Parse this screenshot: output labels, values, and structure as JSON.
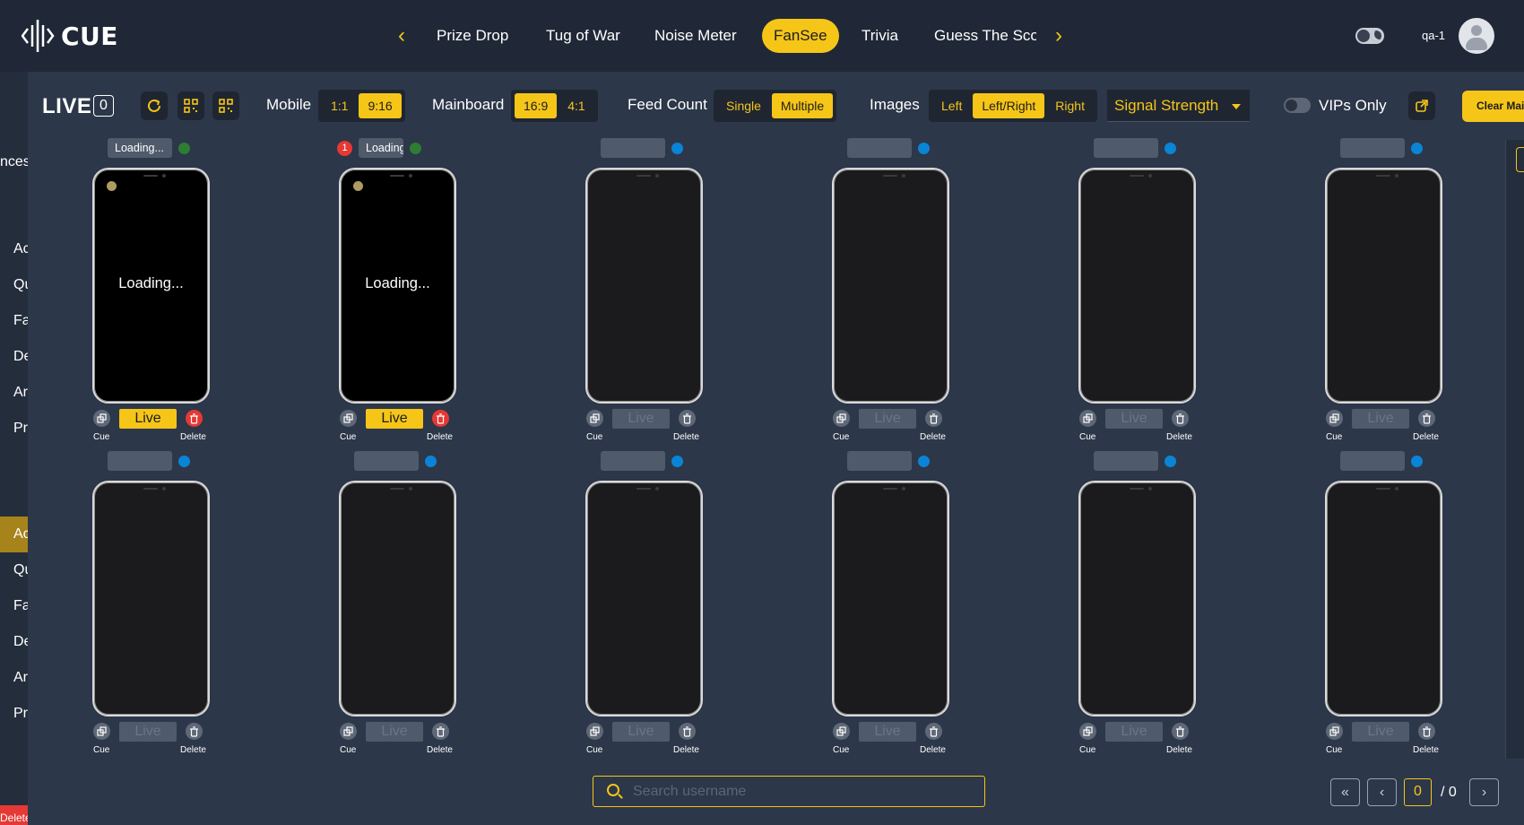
{
  "app": {
    "name": "CUE"
  },
  "nav": {
    "tabs": [
      {
        "label": "Prize Drop"
      },
      {
        "label": "Tug of War"
      },
      {
        "label": "Noise Meter"
      },
      {
        "label": "FanSee",
        "active": true
      },
      {
        "label": "Trivia"
      },
      {
        "label": "Guess The Sco"
      }
    ],
    "prev_icon": "chevron-left-icon",
    "next_icon": "chevron-right-icon"
  },
  "user": {
    "name": "qa-1"
  },
  "sidebar": {
    "top_fragment": "nces",
    "group1": [
      "Ac",
      "Qu",
      "Fa",
      "De",
      "Ar",
      "Pr"
    ],
    "group2": [
      "Ac",
      "Qu",
      "Fa",
      "De",
      "Ar",
      "Pr"
    ],
    "delete_label": "Delete"
  },
  "toolbar": {
    "title": "LIVE",
    "live_count": "0",
    "mobile": {
      "label": "Mobile",
      "options": [
        "1:1",
        "9:16"
      ],
      "selected": "9:16"
    },
    "mainboard": {
      "label": "Mainboard",
      "options": [
        "16:9",
        "4:1"
      ],
      "selected": "16:9"
    },
    "feed_count": {
      "label": "Feed Count",
      "options": [
        "Single",
        "Multiple"
      ],
      "selected": "Multiple"
    },
    "images": {
      "label": "Images",
      "options": [
        "Left",
        "Left/Right",
        "Right"
      ],
      "selected": "Left/Right"
    },
    "signal_select": "Signal Strength",
    "vips_only": {
      "label": "VIPs Only",
      "on": false
    },
    "clear_label": "Clear Mai"
  },
  "cards": [
    {
      "username": "Loading...",
      "status": "green",
      "screen": "Loading...",
      "live": true,
      "live_label": "Live",
      "cue_label": "Cue",
      "delete_label": "Delete"
    },
    {
      "username": "Loading",
      "status": "green",
      "badge": "1",
      "screen": "Loading...",
      "live": true,
      "live_label": "Live",
      "cue_label": "Cue",
      "delete_label": "Delete"
    },
    {
      "username": "",
      "status": "blue",
      "screen": "",
      "live": false,
      "live_label": "Live",
      "cue_label": "Cue",
      "delete_label": "Delete"
    },
    {
      "username": "",
      "status": "blue",
      "screen": "",
      "live": false,
      "live_label": "Live",
      "cue_label": "Cue",
      "delete_label": "Delete"
    },
    {
      "username": "",
      "status": "blue",
      "screen": "",
      "live": false,
      "live_label": "Live",
      "cue_label": "Cue",
      "delete_label": "Delete"
    },
    {
      "username": "",
      "status": "blue",
      "screen": "",
      "live": false,
      "live_label": "Live",
      "cue_label": "Cue",
      "delete_label": "Delete"
    },
    {
      "username": "",
      "status": "blue",
      "screen": "",
      "live": false,
      "live_label": "Live",
      "cue_label": "Cue",
      "delete_label": "Delete"
    },
    {
      "username": "",
      "status": "blue",
      "screen": "",
      "live": false,
      "live_label": "Live",
      "cue_label": "Cue",
      "delete_label": "Delete"
    },
    {
      "username": "",
      "status": "blue",
      "screen": "",
      "live": false,
      "live_label": "Live",
      "cue_label": "Cue",
      "delete_label": "Delete"
    },
    {
      "username": "",
      "status": "blue",
      "screen": "",
      "live": false,
      "live_label": "Live",
      "cue_label": "Cue",
      "delete_label": "Delete"
    },
    {
      "username": "",
      "status": "blue",
      "screen": "",
      "live": false,
      "live_label": "Live",
      "cue_label": "Cue",
      "delete_label": "Delete"
    },
    {
      "username": "",
      "status": "blue",
      "screen": "",
      "live": false,
      "live_label": "Live",
      "cue_label": "Cue",
      "delete_label": "Delete"
    }
  ],
  "search": {
    "placeholder": "Search username",
    "value": ""
  },
  "pagination": {
    "current": "0",
    "total": "/ 0"
  },
  "colors": {
    "accent": "#f5c518",
    "online": "#2e7d32",
    "idle": "#0a84d6",
    "danger": "#e53935"
  }
}
